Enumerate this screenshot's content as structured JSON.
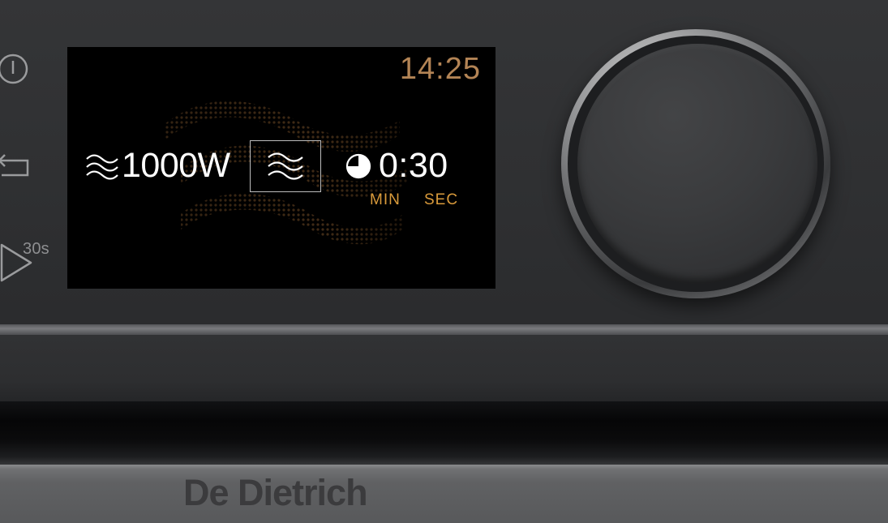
{
  "display": {
    "clock": "14:25",
    "power_value": "1000W",
    "timer_value": "0:30",
    "unit_min": "MIN",
    "unit_sec": "SEC"
  },
  "controls": {
    "power_button_icon": "power-icon",
    "back_button_icon": "back-arrow-icon",
    "start_button_icon": "play-icon",
    "start_button_sub": "30s"
  },
  "brand": {
    "name": "De Dietrich"
  },
  "colors": {
    "clock": "#b38455",
    "units": "#d99a3b",
    "display_bg": "#000000",
    "panel_bg": "#2f3032"
  }
}
